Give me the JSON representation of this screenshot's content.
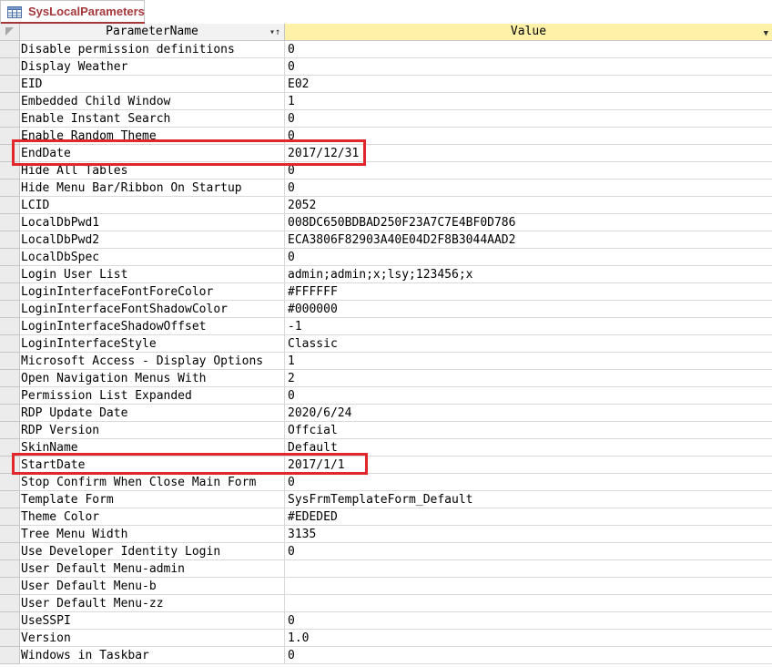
{
  "tab": {
    "label": "SysLocalParameters",
    "icon": "table-icon"
  },
  "columns": {
    "name_header": "ParameterName",
    "value_header": "Value"
  },
  "rows": [
    {
      "name": "Disable permission definitions",
      "value": "0"
    },
    {
      "name": "Display Weather",
      "value": "0"
    },
    {
      "name": "EID",
      "value": "E02"
    },
    {
      "name": "Embedded Child Window",
      "value": "1"
    },
    {
      "name": "Enable Instant Search",
      "value": "0"
    },
    {
      "name": "Enable Random Theme",
      "value": "0"
    },
    {
      "name": "EndDate",
      "value": "2017/12/31"
    },
    {
      "name": "Hide All Tables",
      "value": "0"
    },
    {
      "name": "Hide Menu Bar/Ribbon On Startup",
      "value": "0"
    },
    {
      "name": "LCID",
      "value": "2052"
    },
    {
      "name": "LocalDbPwd1",
      "value": "008DC650BDBAD250F23A7C7E4BF0D786"
    },
    {
      "name": "LocalDbPwd2",
      "value": "ECA3806F82903A40E04D2F8B3044AAD2"
    },
    {
      "name": "LocalDbSpec",
      "value": "0"
    },
    {
      "name": "Login User List",
      "value": "admin;admin;x;lsy;123456;x"
    },
    {
      "name": "LoginInterfaceFontForeColor",
      "value": "#FFFFFF"
    },
    {
      "name": "LoginInterfaceFontShadowColor",
      "value": "#000000"
    },
    {
      "name": "LoginInterfaceShadowOffset",
      "value": "-1"
    },
    {
      "name": "LoginInterfaceStyle",
      "value": "Classic"
    },
    {
      "name": "Microsoft Access - Display Options",
      "value": "1"
    },
    {
      "name": "Open Navigation Menus With",
      "value": "2"
    },
    {
      "name": "Permission List Expanded",
      "value": "0"
    },
    {
      "name": "RDP Update Date",
      "value": "2020/6/24"
    },
    {
      "name": "RDP Version",
      "value": "Offcial"
    },
    {
      "name": "SkinName",
      "value": "Default"
    },
    {
      "name": "StartDate",
      "value": "2017/1/1"
    },
    {
      "name": "Stop Confirm When Close Main Form",
      "value": "0"
    },
    {
      "name": "Template Form",
      "value": "SysFrmTemplateForm_Default"
    },
    {
      "name": "Theme Color",
      "value": "#EDEDED"
    },
    {
      "name": "Tree Menu Width",
      "value": "3135"
    },
    {
      "name": "Use Developer Identity Login",
      "value": "0"
    },
    {
      "name": "User Default Menu-admin",
      "value": ""
    },
    {
      "name": "User Default Menu-b",
      "value": ""
    },
    {
      "name": "User Default Menu-zz",
      "value": ""
    },
    {
      "name": "UseSSPI",
      "value": "0"
    },
    {
      "name": "Version",
      "value": "1.0"
    },
    {
      "name": "Windows in Taskbar",
      "value": "0"
    }
  ],
  "highlighted_rows": [
    "EndDate",
    "StartDate"
  ],
  "colors": {
    "tab_accent": "#a4373a",
    "value_header_bg": "#fff2a8",
    "highlight": "#e0272b"
  }
}
